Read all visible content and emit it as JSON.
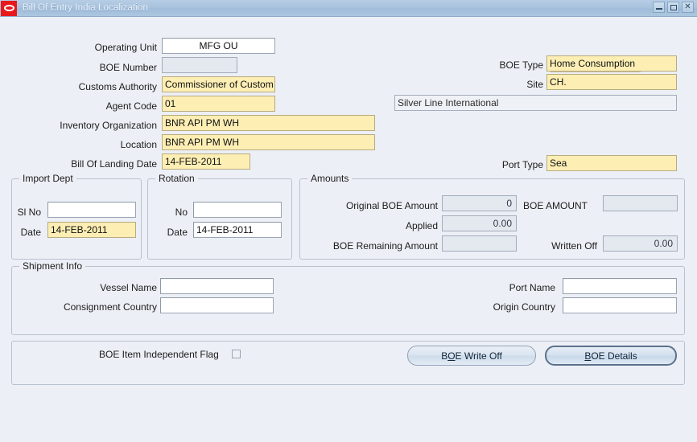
{
  "window": {
    "title": "Bill Of Entry India Localization",
    "logo_icon": "oracle-logo-icon",
    "minimize_label": "",
    "maximize_label": "",
    "close_label": "✕"
  },
  "form": {
    "left_fields": [
      {
        "label": "Operating Unit",
        "value": "MFG OU",
        "style": "white-center"
      },
      {
        "label": "BOE Number",
        "value": "",
        "style": "disabled"
      },
      {
        "label": "Customs Authority",
        "value": "Commissioner of Custom",
        "style": "required"
      },
      {
        "label": "Agent Code",
        "value": "01",
        "style": "required"
      },
      {
        "label": "Inventory Organization",
        "value": "BNR API PM WH",
        "style": "required"
      },
      {
        "label": "Location",
        "value": "BNR API PM WH",
        "style": "required"
      },
      {
        "label": "Bill Of Landing Date",
        "value": "14-FEB-2011",
        "style": "required"
      }
    ],
    "right_fields": [
      {
        "label": "BOE Type",
        "value": "Home Consumption",
        "style": "required"
      },
      {
        "label": "Site",
        "value": "CH.",
        "style": "required"
      },
      {
        "label": "Port Type",
        "value": "Sea",
        "style": "required"
      }
    ],
    "agent_name": "Silver Line International"
  },
  "import_dept": {
    "title": "Import Dept",
    "sl_no_label": "Sl No",
    "sl_no_value": "",
    "date_label": "Date",
    "date_value": "14-FEB-2011"
  },
  "rotation": {
    "title": "Rotation",
    "no_label": "No",
    "no_value": "",
    "date_label": "Date",
    "date_value": "14-FEB-2011"
  },
  "amounts": {
    "title": "Amounts",
    "original_boe_amount_label": "Original BOE Amount",
    "original_boe_amount_value": "0",
    "applied_label": "Applied",
    "applied_value": "0.00",
    "boe_remaining_amount_label": "BOE Remaining Amount",
    "boe_remaining_amount_value": "",
    "boe_amount_label": "BOE AMOUNT",
    "boe_amount_value": "",
    "written_off_label": "Written Off",
    "written_off_value": "0.00"
  },
  "shipment_info": {
    "title": "Shipment Info",
    "vessel_name_label": "Vessel Name",
    "vessel_name_value": "",
    "consignment_country_label": "Consignment Country",
    "consignment_country_value": "",
    "port_name_label": "Port Name",
    "port_name_value": "",
    "origin_country_label": "Origin Country",
    "origin_country_value": ""
  },
  "actions": {
    "flag_label": "BOE Item Independent Flag",
    "flag_checked": false,
    "write_off_pre": "B",
    "write_off_mnemonic": "O",
    "write_off_post": "E Write Off",
    "details_mnemonic": "B",
    "details_post": "OE Details"
  },
  "colors": {
    "background": "#eceff5",
    "required_field": "#fdeeb4",
    "titlebar": "#a9c3de",
    "logo_red": "#e8191b",
    "default_button_border": "#5b718c"
  }
}
